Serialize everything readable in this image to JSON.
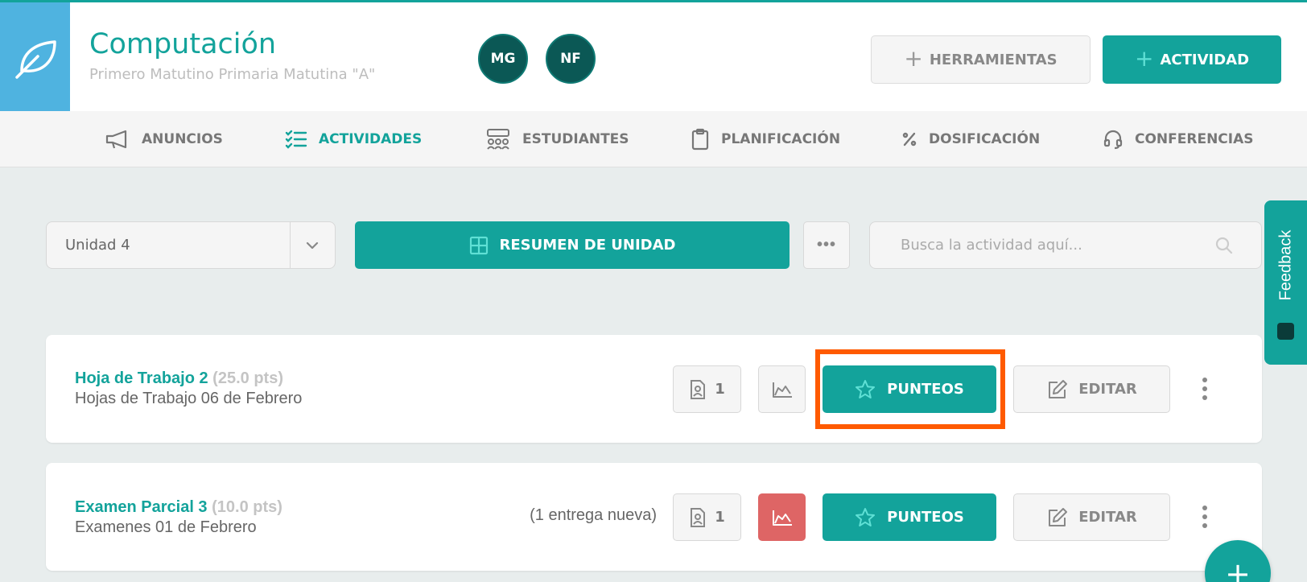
{
  "header": {
    "course_title": "Computación",
    "course_subtitle": "Primero Matutino Primaria Matutina \"A\"",
    "avatars": [
      "MG",
      "NF"
    ],
    "tools_label": "HERRAMIENTAS",
    "activity_label": "ACTIVIDAD",
    "plus_symbol": "+"
  },
  "nav": {
    "items": [
      {
        "label": "ANUNCIOS",
        "icon": "megaphone-icon",
        "active": false
      },
      {
        "label": "ACTIVIDADES",
        "icon": "checklist-icon",
        "active": true
      },
      {
        "label": "ESTUDIANTES",
        "icon": "students-icon",
        "active": false
      },
      {
        "label": "PLANIFICACIÓN",
        "icon": "clipboard-icon",
        "active": false
      },
      {
        "label": "DOSIFICACIÓN",
        "icon": "percent-icon",
        "active": false
      },
      {
        "label": "CONFERENCIAS",
        "icon": "headset-icon",
        "active": false
      }
    ]
  },
  "toolbar": {
    "unit_value": "Unidad 4",
    "summary_label": "RESUMEN DE UNIDAD",
    "more_label": "•••",
    "search_placeholder": "Busca la actividad aquí..."
  },
  "feedback_label": "Feedback",
  "activities": [
    {
      "name": "Hoja de Trabajo 2",
      "points": "(25.0 pts)",
      "subtitle": "Hojas de Trabajo 06 de Febrero",
      "new_submissions": "",
      "submission_count": "1",
      "chart_alert": false,
      "grades_label": "PUNTEOS",
      "edit_label": "EDITAR"
    },
    {
      "name": "Examen Parcial 3",
      "points": "(10.0 pts)",
      "subtitle": "Examenes 01 de Febrero",
      "new_submissions": "(1 entrega nueva)",
      "submission_count": "1",
      "chart_alert": true,
      "grades_label": "PUNTEOS",
      "edit_label": "EDITAR"
    }
  ],
  "fab_label": "+",
  "colors": {
    "teal": "#13a39b",
    "logo_blue": "#4fb3e0",
    "avatar": "#0b5855",
    "alert_red": "#de6565",
    "highlight": "#ff5a00"
  }
}
